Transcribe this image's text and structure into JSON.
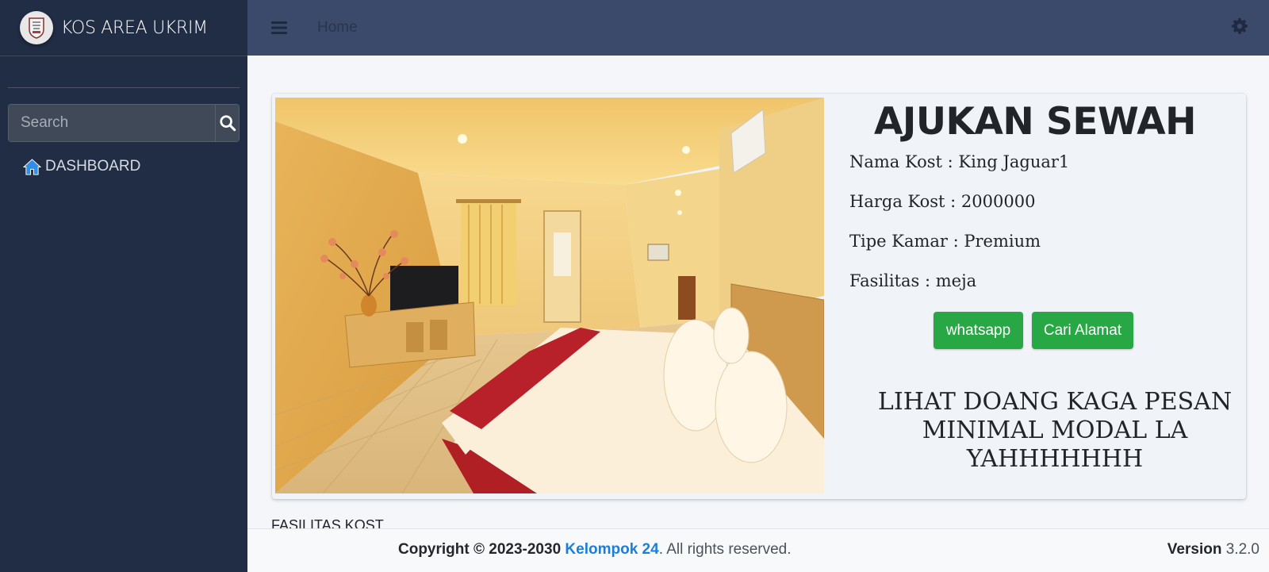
{
  "brand": {
    "name": "KOS AREA UKRIM"
  },
  "sidebar": {
    "search_placeholder": "Search",
    "items": [
      {
        "label": "DASHBOARD",
        "icon": "home-icon"
      }
    ]
  },
  "navbar": {
    "home_label": "Home"
  },
  "room": {
    "title": "AJUKAN SEWAH",
    "nama": "Nama Kost : King Jaguar1",
    "harga": "Harga Kost : 2000000",
    "tipe": "Tipe Kamar : Premium",
    "fasilitas": "Fasilitas : meja",
    "whatsapp_label": "whatsapp",
    "alamat_label": "Cari Alamat",
    "promo_line1": "LIHAT DOANG KAGA PESAN",
    "promo_line2": "MINIMAL MODAL LA",
    "promo_line3": "YAHHHHHHH"
  },
  "section": {
    "fasilitas_heading": "FASILITAS KOST"
  },
  "footer": {
    "copyright_prefix": "Copyright © 2023-2030 ",
    "team": "Kelompok 24",
    "suffix": ". All rights reserved.",
    "version_label": "Version",
    "version_value": "3.2.0"
  },
  "colors": {
    "sidebar_bg": "#212c45",
    "navbar_bg": "#3b4a6b",
    "button_green": "#28a745",
    "link_blue": "#1a7fd8"
  }
}
